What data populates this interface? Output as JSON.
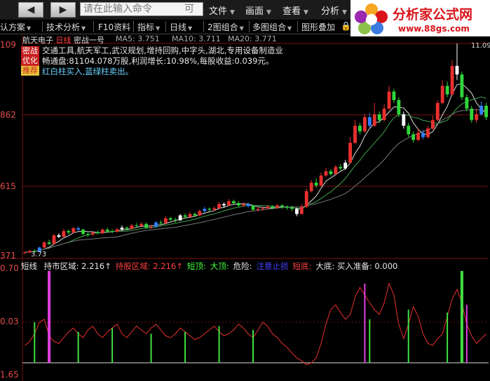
{
  "toolbar": {
    "back_label": "◀",
    "forward_label": "▶",
    "command_placeholder": "请在此输入命令",
    "command_tail": "可",
    "menus": [
      "文件",
      "画面",
      "查看",
      "分析"
    ]
  },
  "logo": {
    "title": "分析家公式网",
    "url": "www.88gs.com"
  },
  "secondary_toolbar": [
    "认方案",
    "技术分析",
    "F10资料",
    "指标",
    "日线",
    "2图组合",
    "多图组合",
    "图形叠加"
  ],
  "stock": {
    "name": "航天电子",
    "period": "日线",
    "formula": "密战一号",
    "ma5": "MA5: 3.751",
    "ma10": "MA10: 3.711",
    "ma20": "MA20: 3.771"
  },
  "badges": [
    "密战",
    "优化",
    "推荐"
  ],
  "info_lines": [
    "交通工具,航天军工,武汉规划,增持回购,中字头,湖北,专用设备制造业",
    "畅通盘:81104.078万股,利润增长:10.98%,每股收益:0.039元。",
    "红白柱买入,蓝绿柱卖出。"
  ],
  "y_axis_labels": [
    "109",
    "862",
    "615",
    "371"
  ],
  "price_annotations": {
    "high": "11.09",
    "low": "3.73"
  },
  "indicator": {
    "name": "短线",
    "items": [
      {
        "label": "持市区域: 2.216↑",
        "color": "#e8e8e8"
      },
      {
        "label": "持股区域: 2.216↑",
        "color": "#ff4040"
      },
      {
        "label": "短顶:",
        "color": "#40ff40"
      },
      {
        "label": "大顶:",
        "color": "#40ff40"
      },
      {
        "label": "危险:",
        "color": "#e8e8e8"
      },
      {
        "label": "注意止损",
        "color": "#4040ff"
      },
      {
        "label": "短底:",
        "color": "#ff4040"
      },
      {
        "label": "大底: 买入准备: 0.000",
        "color": "#e8e8e8"
      }
    ],
    "y_axis_labels": [
      "0.70",
      "0.03",
      "1.65"
    ]
  },
  "colors": {
    "up": "#e8302f",
    "down": "#2fd63a",
    "buy": "#ffffff",
    "sell": "#3080ff",
    "grid": "#7a1010"
  },
  "chart_data": {
    "type": "candlestick",
    "price_range": [
      3.71,
      11.09
    ],
    "candles": [
      [
        3.72,
        3.75,
        3.7,
        3.78
      ],
      [
        3.75,
        3.8,
        3.72,
        3.84
      ],
      [
        3.8,
        3.78,
        3.75,
        3.86
      ],
      [
        3.78,
        3.92,
        3.76,
        3.95
      ],
      [
        3.92,
        4.1,
        3.9,
        4.15
      ],
      [
        4.1,
        4.05,
        4.0,
        4.2
      ],
      [
        4.05,
        4.35,
        4.03,
        4.4
      ],
      [
        4.35,
        4.3,
        4.25,
        4.42
      ],
      [
        4.3,
        4.5,
        4.28,
        4.58
      ],
      [
        4.5,
        4.45,
        4.38,
        4.55
      ],
      [
        4.45,
        4.6,
        4.42,
        4.65
      ],
      [
        4.6,
        4.55,
        4.5,
        4.66
      ],
      [
        4.55,
        4.4,
        4.35,
        4.58
      ],
      [
        4.4,
        4.38,
        4.3,
        4.45
      ],
      [
        4.38,
        4.45,
        4.32,
        4.5
      ],
      [
        4.45,
        4.42,
        4.38,
        4.52
      ],
      [
        4.42,
        4.55,
        4.4,
        4.6
      ],
      [
        4.55,
        4.5,
        4.45,
        4.62
      ],
      [
        4.5,
        4.48,
        4.42,
        4.56
      ],
      [
        4.48,
        4.56,
        4.45,
        4.62
      ],
      [
        4.56,
        4.62,
        4.5,
        4.7
      ],
      [
        4.62,
        4.58,
        4.52,
        4.66
      ],
      [
        4.58,
        4.7,
        4.55,
        4.75
      ],
      [
        4.7,
        4.68,
        4.62,
        4.78
      ],
      [
        4.68,
        4.75,
        4.64,
        4.82
      ],
      [
        4.75,
        4.62,
        4.58,
        4.8
      ],
      [
        4.62,
        4.65,
        4.58,
        4.72
      ],
      [
        4.65,
        4.8,
        4.62,
        4.85
      ],
      [
        4.8,
        4.78,
        4.72,
        4.88
      ],
      [
        4.78,
        4.95,
        4.75,
        5.02
      ],
      [
        4.95,
        4.9,
        4.85,
        5.0
      ],
      [
        4.9,
        4.88,
        4.8,
        4.96
      ],
      [
        4.88,
        5.05,
        4.85,
        5.1
      ],
      [
        5.05,
        5.0,
        4.95,
        5.12
      ],
      [
        5.0,
        5.1,
        4.96,
        5.18
      ],
      [
        5.1,
        5.05,
        5.0,
        5.15
      ],
      [
        5.05,
        5.2,
        5.02,
        5.25
      ],
      [
        5.2,
        5.28,
        5.15,
        5.35
      ],
      [
        5.28,
        5.25,
        5.18,
        5.33
      ],
      [
        5.25,
        5.3,
        5.2,
        5.38
      ],
      [
        5.3,
        5.45,
        5.26,
        5.52
      ],
      [
        5.45,
        5.4,
        5.32,
        5.5
      ],
      [
        5.4,
        5.55,
        5.38,
        5.62
      ],
      [
        5.55,
        5.48,
        5.42,
        5.6
      ],
      [
        5.48,
        5.4,
        5.35,
        5.55
      ],
      [
        5.4,
        5.45,
        5.36,
        5.52
      ],
      [
        5.45,
        5.38,
        5.32,
        5.5
      ],
      [
        5.38,
        5.25,
        5.2,
        5.42
      ],
      [
        5.25,
        5.28,
        5.18,
        5.35
      ],
      [
        5.28,
        5.3,
        5.22,
        5.36
      ],
      [
        5.3,
        5.36,
        5.26,
        5.42
      ],
      [
        5.36,
        5.32,
        5.26,
        5.4
      ],
      [
        5.32,
        5.4,
        5.28,
        5.46
      ],
      [
        5.4,
        5.35,
        5.28,
        5.44
      ],
      [
        5.35,
        5.32,
        5.25,
        5.4
      ],
      [
        5.32,
        5.28,
        5.2,
        5.38
      ],
      [
        5.28,
        5.1,
        5.02,
        5.32
      ],
      [
        5.1,
        5.35,
        5.08,
        5.45
      ],
      [
        5.35,
        5.9,
        5.32,
        6.0
      ],
      [
        5.9,
        6.2,
        5.85,
        6.3
      ],
      [
        6.2,
        6.1,
        6.02,
        6.35
      ],
      [
        6.1,
        6.45,
        6.05,
        6.55
      ],
      [
        6.45,
        6.6,
        6.4,
        6.72
      ],
      [
        6.6,
        6.5,
        6.45,
        6.68
      ],
      [
        6.5,
        6.75,
        6.48,
        6.82
      ],
      [
        6.75,
        6.7,
        6.62,
        6.85
      ],
      [
        6.7,
        6.9,
        6.65,
        7.0
      ],
      [
        6.9,
        7.6,
        6.86,
        7.8
      ],
      [
        7.6,
        8.2,
        7.55,
        8.4
      ],
      [
        8.2,
        8.0,
        7.9,
        8.3
      ],
      [
        8.0,
        8.5,
        7.95,
        8.62
      ],
      [
        8.5,
        8.2,
        8.1,
        8.65
      ],
      [
        8.2,
        8.6,
        8.15,
        9.0
      ],
      [
        8.6,
        8.4,
        8.3,
        8.7
      ],
      [
        8.4,
        8.8,
        8.35,
        8.95
      ],
      [
        8.8,
        9.4,
        8.76,
        9.6
      ],
      [
        9.4,
        9.1,
        9.0,
        9.5
      ],
      [
        9.1,
        8.6,
        8.5,
        9.2
      ],
      [
        8.6,
        8.2,
        8.1,
        8.7
      ],
      [
        8.2,
        7.9,
        7.8,
        8.3
      ],
      [
        7.9,
        7.7,
        7.6,
        8.0
      ],
      [
        7.7,
        7.95,
        7.65,
        8.1
      ],
      [
        7.95,
        7.8,
        7.72,
        8.05
      ],
      [
        7.8,
        8.1,
        7.75,
        8.2
      ],
      [
        8.1,
        8.4,
        8.05,
        8.55
      ],
      [
        8.4,
        9.0,
        8.36,
        9.1
      ],
      [
        9.0,
        9.6,
        8.95,
        9.8
      ],
      [
        9.6,
        9.3,
        9.2,
        9.75
      ],
      [
        9.3,
        10.3,
        9.25,
        10.5
      ],
      [
        10.3,
        10.0,
        9.8,
        11.09
      ],
      [
        10.0,
        9.2,
        9.1,
        10.1
      ],
      [
        9.2,
        8.8,
        8.7,
        9.3
      ],
      [
        8.8,
        8.4,
        8.3,
        8.9
      ],
      [
        8.4,
        8.6,
        8.3,
        8.8
      ],
      [
        8.6,
        8.9,
        8.55,
        9.05
      ],
      [
        8.9,
        8.5,
        8.4,
        9.0
      ]
    ],
    "signals": {
      "buy": [
        7,
        20,
        32,
        41,
        56,
        66,
        78,
        89
      ],
      "sell": [
        3,
        11,
        27,
        37,
        46,
        71,
        82,
        94
      ]
    },
    "ma_lines": {
      "ma5": "white",
      "ma10": "green",
      "ma20": "gray"
    },
    "indicator_values": [
      0.18,
      0.22,
      0.3,
      0.42,
      0.45,
      0.28,
      0.22,
      0.2,
      0.26,
      0.32,
      0.36,
      0.3,
      0.26,
      0.34,
      0.38,
      0.3,
      0.26,
      0.32,
      0.36,
      0.4,
      0.3,
      0.26,
      0.32,
      0.38,
      0.34,
      0.3,
      0.36,
      0.4,
      0.34,
      0.28,
      0.26,
      0.3,
      0.36,
      0.32,
      0.28,
      0.24,
      0.26,
      0.3,
      0.34,
      0.38,
      0.32,
      0.28,
      0.3,
      0.34,
      0.4,
      0.36,
      0.3,
      0.26,
      0.34,
      0.42,
      0.38,
      0.3,
      0.26,
      0.2,
      0.16,
      0.1,
      0.05,
      0.02,
      -0.02,
      0.0,
      0.05,
      0.2,
      0.4,
      0.55,
      0.6,
      0.52,
      0.45,
      0.5,
      0.68,
      0.78,
      0.7,
      0.62,
      0.55,
      0.5,
      0.62,
      0.82,
      0.7,
      0.4,
      0.25,
      0.4,
      0.58,
      0.48,
      0.3,
      0.2,
      0.18,
      0.25,
      0.3,
      0.48,
      0.66,
      0.76,
      0.62,
      0.4,
      0.28,
      0.2,
      0.25,
      0.3
    ],
    "indicator_bars": [
      {
        "i": 5,
        "v": 0.95,
        "color": "#e040e0"
      },
      {
        "i": 2,
        "v": 0.42,
        "color": "#40e040"
      },
      {
        "i": 11,
        "v": 0.32,
        "color": "#40e040"
      },
      {
        "i": 18,
        "v": 0.36,
        "color": "#40e040"
      },
      {
        "i": 26,
        "v": 0.3,
        "color": "#40e040"
      },
      {
        "i": 33,
        "v": 0.32,
        "color": "#40e040"
      },
      {
        "i": 40,
        "v": 0.38,
        "color": "#40e040"
      },
      {
        "i": 47,
        "v": 0.34,
        "color": "#40e040"
      },
      {
        "i": 70,
        "v": 0.82,
        "color": "#e040e0"
      },
      {
        "i": 71,
        "v": 0.45,
        "color": "#40e040"
      },
      {
        "i": 79,
        "v": 0.55,
        "color": "#40e040"
      },
      {
        "i": 87,
        "v": 0.52,
        "color": "#40e040"
      },
      {
        "i": 90,
        "v": 0.95,
        "color": "#40e040"
      },
      {
        "i": 91,
        "v": 0.6,
        "color": "#e040e0"
      }
    ]
  }
}
